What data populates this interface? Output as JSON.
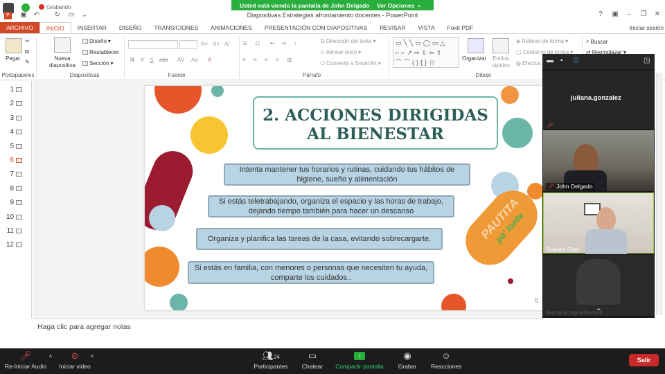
{
  "share_banner": {
    "message": "Usted está viendo la pantalla de John Delgado",
    "options_label": "Ver Opciones"
  },
  "window": {
    "title": "Diapositivas Estrategias afrontamiento docentes - PowerPoint",
    "saving": "Grabando"
  },
  "tabs": [
    {
      "label": "ARCHIVO"
    },
    {
      "label": "INICIO"
    },
    {
      "label": "INSERTAR"
    },
    {
      "label": "DISEÑO"
    },
    {
      "label": "TRANSICIONES"
    },
    {
      "label": "ANIMACIONES"
    },
    {
      "label": "PRESENTACIÓN CON DIAPOSITIVAS"
    },
    {
      "label": "REVISAR"
    },
    {
      "label": "VISTA"
    },
    {
      "label": "Foxit PDF"
    }
  ],
  "signin": "Iniciar sesión",
  "ribbon": {
    "portapapeles": {
      "label": "Portapapeles",
      "paste": "Pegar"
    },
    "diapositivas": {
      "label": "Diapositivas",
      "new_slide": "Nueva diapositiva",
      "layout": "Diseño",
      "reset": "Restablecer",
      "section": "Sección"
    },
    "fuente": {
      "label": "Fuente"
    },
    "parrafo": {
      "label": "Párrafo",
      "text_direction": "Dirección del texto",
      "align_text": "Alinear texto",
      "smartart": "Convertir a SmartArt"
    },
    "dibujo": {
      "label": "Dibujo",
      "arrange": "Organizar",
      "quick_styles": "Estilos rápidos",
      "fill": "Relleno de forma",
      "outline": "Contorno de forma",
      "effects": "Efectos"
    },
    "edicion": {
      "find": "Buscar",
      "replace": "Reemplazar"
    }
  },
  "thumbnails": [
    "1",
    "2",
    "3",
    "4",
    "5",
    "6",
    "7",
    "8",
    "9",
    "10",
    "11",
    "12"
  ],
  "selected_slide": "6",
  "slide": {
    "title": "2. ACCIONES DIRIGIDAS AL BIENESTAR",
    "tips": [
      "Intenta mantener tus horarios y rutinas, cuidando tus hábitos de higiene, sueño y alimentación",
      "Si estás teletrabajando, organiza el espacio y las horas de trabajo, dejando  tiempo también para hacer un descanso",
      "Organiza y planifica las tareas de la casa, evitando sobrecargarte.",
      "Si estás en familia, con menores o personas que necesiten tu ayuda, comparte los cuidados.."
    ],
    "badge": {
      "line1": "PAUTITA",
      "line2": "pa' tonte"
    },
    "number": "6"
  },
  "notes_placeholder": "Haga clic para agregar notas",
  "gallery": {
    "participants": [
      {
        "name": "juliana.gonzalez"
      },
      {
        "name": "John Delgado"
      },
      {
        "name": "Sandra Díaz"
      },
      {
        "name": "diazaparragra@email..."
      }
    ]
  },
  "zoom_toolbar": {
    "audio": "Re-Iniciar Audio",
    "video": "Iniciar video",
    "participants": "Participantes",
    "participants_count": "24",
    "chat": "Chatear",
    "share": "Compartir pantalla",
    "record": "Grabar",
    "reactions": "Reacciones",
    "leave": "Salir"
  },
  "colors": {
    "accent": "#d24726",
    "zoom_green": "#27ae3b",
    "teal": "#2d5e5a",
    "tip_fill": "#b8d4e2"
  }
}
